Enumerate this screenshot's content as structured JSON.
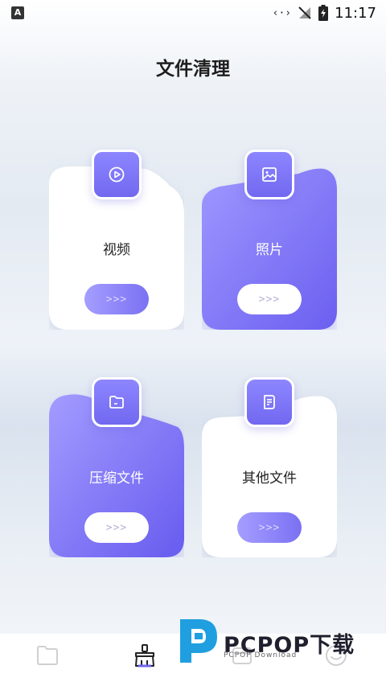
{
  "status": {
    "time": "11:17",
    "left_badge": "A"
  },
  "page_title": "文件清理",
  "cards": [
    {
      "label": "视频",
      "go": ">>>"
    },
    {
      "label": "照片",
      "go": ">>>"
    },
    {
      "label": "压缩文件",
      "go": ">>>"
    },
    {
      "label": "其他文件",
      "go": ">>>"
    }
  ],
  "watermark": {
    "title": "PCPOP下载",
    "subtitle": "PCPOP Download"
  },
  "colors": {
    "accent": "#7a71f2",
    "accent_light": "#a59eff"
  }
}
